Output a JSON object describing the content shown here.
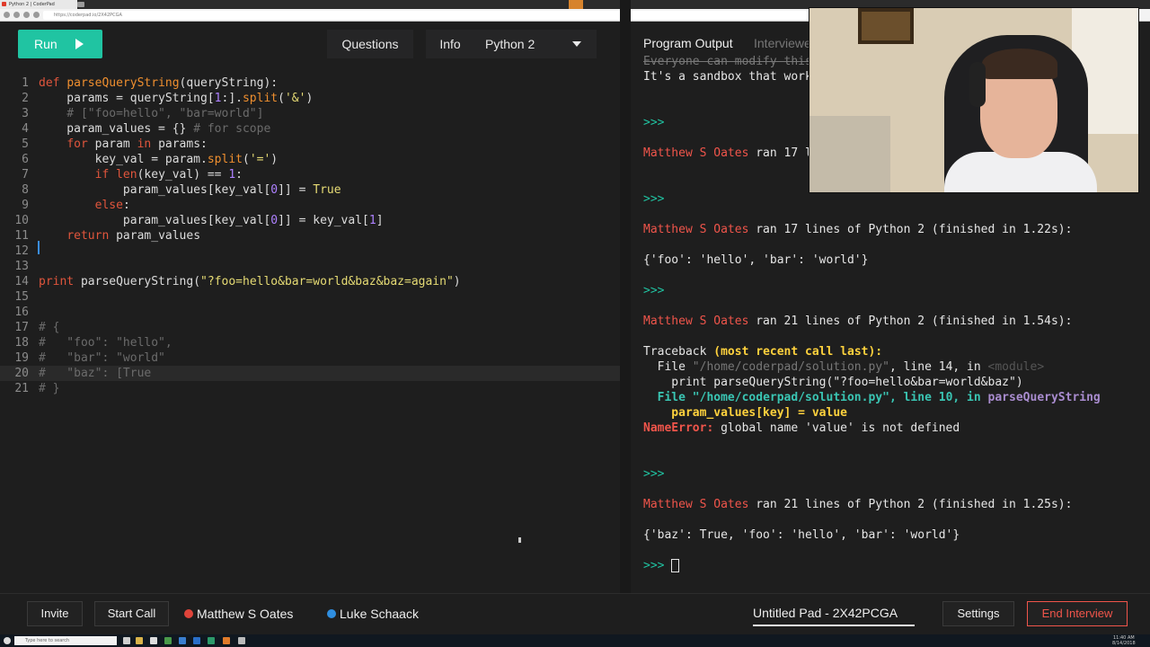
{
  "browser": {
    "tab_title": "Python 2 | CoderPad",
    "url": "https://coderpad.io/2X42PCGA"
  },
  "toolbar": {
    "run_label": "Run",
    "questions_label": "Questions",
    "info_label": "Info",
    "language_label": "Python 2"
  },
  "editor": {
    "line_numbers": [
      "1",
      "2",
      "3",
      "4",
      "5",
      "6",
      "7",
      "8",
      "9",
      "10",
      "11",
      "12",
      "13",
      "14",
      "15",
      "16",
      "17",
      "18",
      "19",
      "20",
      "21"
    ],
    "lines": [
      "def parseQueryString(queryString):",
      "    params = queryString[1:].split('&')",
      "    # [\"foo=hello\", \"bar=world\"]",
      "    param_values = {} # for scope",
      "    for param in params:",
      "        key_val = param.split('=')",
      "        if len(key_val) == 1:",
      "            param_values[key_val[0]] = True",
      "        else:",
      "            param_values[key_val[0]] = key_val[1]",
      "    return param_values",
      "",
      "",
      "print parseQueryString(\"?foo=hello&bar=world&baz&baz=again\")",
      "",
      "",
      "# {",
      "#   \"foo\": \"hello\",",
      "#   \"bar\": \"world\"",
      "#   \"baz\": [True",
      "# }"
    ]
  },
  "output": {
    "tab_program_output": "Program Output",
    "tab_interviewer": "Interviewer Notes",
    "sandbox_line_1": "Everyone can modify this pad.",
    "sandbox_line_2": "It's a sandbox that works like a REPL.",
    "prompt": ">>>",
    "run1_user": "Matthew S Oates",
    "run1_text": " ran 17 lines of Python 2 (finished in 1.22s):",
    "run2_user": "Matthew S Oates",
    "run2_text": " ran 17 lines of Python 2 (finished in 1.22s):",
    "run2_result": "{'foo': 'hello', 'bar': 'world'}",
    "run3_user": "Matthew S Oates",
    "run3_text": " ran 21 lines of Python 2 (finished in 1.54s):",
    "tb_head_1": "Traceback ",
    "tb_head_2": "(most recent call last):",
    "tb_file1_pre": "  File ",
    "tb_file1_path": "\"/home/coderpad/solution.py\"",
    "tb_file1_line": ", line 14, in ",
    "tb_file1_mod": "<module>",
    "tb_code1": "    print parseQueryString(\"?foo=hello&bar=world&baz\")",
    "tb_file2_pre": "  File ",
    "tb_file2_path": "\"/home/coderpad/solution.py\"",
    "tb_file2_line": ", line 10, in ",
    "tb_file2_fn": "parseQueryString",
    "tb_code2": "    param_values[key] = value",
    "tb_err_name": "NameError:",
    "tb_err_msg": " global name 'value' is not defined",
    "run4_user": "Matthew S Oates",
    "run4_text": " ran 21 lines of Python 2 (finished in 1.25s):",
    "run4_result": "{'baz': True, 'foo': 'hello', 'bar': 'world'}"
  },
  "footer": {
    "invite_label": "Invite",
    "start_call_label": "Start Call",
    "participant_1": "Matthew S Oates",
    "participant_2": "Luke Schaack",
    "pad_title": "Untitled Pad - 2X42PCGA",
    "settings_label": "Settings",
    "end_interview_label": "End Interview"
  },
  "taskbar": {
    "search_placeholder": "Type here to search",
    "time": "11:40 AM",
    "date": "8/14/2018"
  },
  "colors": {
    "accent": "#20c4a2",
    "participant_1_dot": "#e0443a",
    "participant_2_dot": "#2f8ee0",
    "end_interview": "#f0554b"
  }
}
